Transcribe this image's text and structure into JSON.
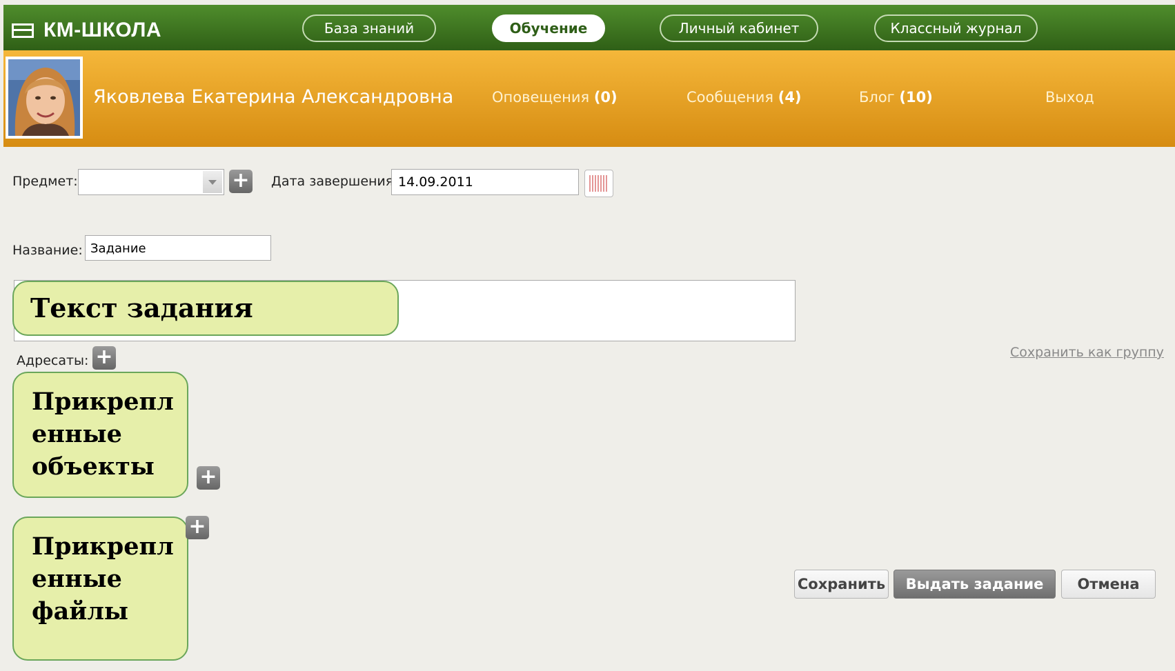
{
  "app": {
    "title": "КМ-ШКОЛА"
  },
  "nav": {
    "tabs": [
      {
        "label": "База знаний"
      },
      {
        "label": "Обучение"
      },
      {
        "label": "Личный кабинет"
      },
      {
        "label": "Классный журнал"
      }
    ]
  },
  "user": {
    "name": "Яковлева Екатерина Александровна",
    "notifications": {
      "label": "Оповещения",
      "count": "(0)"
    },
    "messages": {
      "label": "Сообщения",
      "count": "(4)"
    },
    "blog": {
      "label": "Блог",
      "count": "(10)"
    },
    "logout": "Выход"
  },
  "form": {
    "subject_label": "Предмет:",
    "subject_value": "",
    "due_date_label": "Дата завершения:",
    "due_date_value": "14.09.2011",
    "name_label": "Название:",
    "name_value": "Задание",
    "recipients_label": "Адресаты:",
    "save_as_group": "Сохранить как группу"
  },
  "callouts": {
    "task_text": "Текст задания",
    "attached_objects": "Прикрепл енные объекты",
    "attached_files": "Прикрепл енные файлы"
  },
  "buttons": {
    "save": "Сохранить",
    "issue": "Выдать задание",
    "cancel": "Отмена"
  },
  "colors": {
    "topbar": "#3b7420",
    "userbar": "#e9a126",
    "callout_fill": "#e6efaa",
    "callout_border": "#6aa65a"
  }
}
